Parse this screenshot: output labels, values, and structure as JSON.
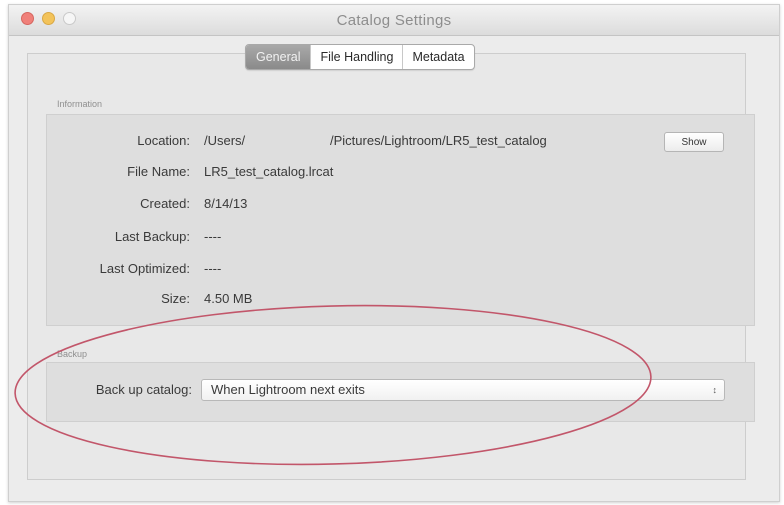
{
  "window": {
    "title": "Catalog Settings"
  },
  "tabs": [
    {
      "label": "General",
      "active": true
    },
    {
      "label": "File Handling",
      "active": false
    },
    {
      "label": "Metadata",
      "active": false
    }
  ],
  "information": {
    "section_label": "Information",
    "location_label": "Location:",
    "location_user": "/Users/",
    "location_path": "/Pictures/Lightroom/LR5_test_catalog",
    "show_button": "Show",
    "file_name_label": "File Name:",
    "file_name_value": "LR5_test_catalog.lrcat",
    "created_label": "Created:",
    "created_value": "8/14/13",
    "last_backup_label": "Last Backup:",
    "last_backup_value": "----",
    "last_optimized_label": "Last Optimized:",
    "last_optimized_value": "----",
    "size_label": "Size:",
    "size_value": "4.50 MB"
  },
  "backup": {
    "section_label": "Backup",
    "label": "Back up catalog:",
    "selected": "When Lightroom next exits",
    "arrow_icon": "updown-arrows-icon"
  },
  "annotation": {
    "color": "#c2566a"
  }
}
